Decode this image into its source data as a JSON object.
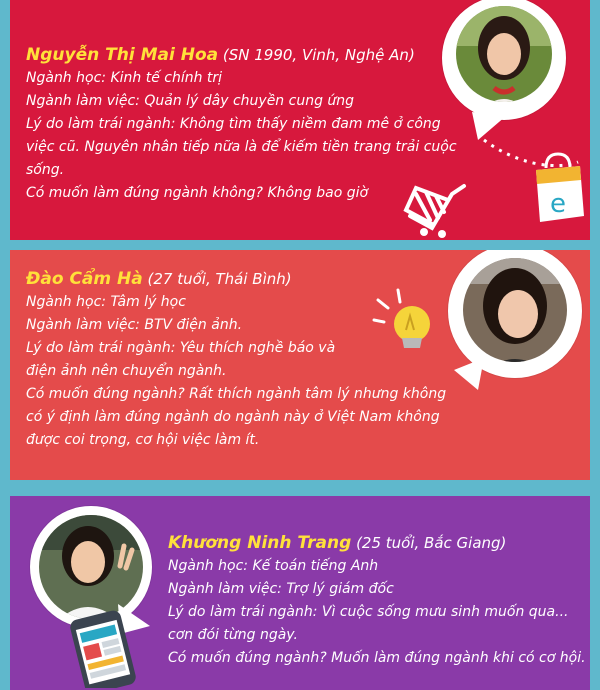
{
  "profiles": [
    {
      "name": "Nguyễn Thị Mai Hoa",
      "info": "(SN 1990, Vinh, Nghệ An)",
      "lines": [
        "Ngành học: Kinh tế chính trị",
        "Ngành làm việc: Quản lý dây chuyền cung ứng",
        "Lý do làm trái ngành: Không tìm thấy niềm đam mê ở công",
        "việc cũ. Nguyên nhân tiếp nữa là để kiếm tiền trang trải cuộc",
        "sống.",
        "Có muốn làm đúng ngành không? Không bao giờ"
      ],
      "icon_letter": "e"
    },
    {
      "name": "Đào Cẩm Hà",
      "info": "(27 tuổi, Thái Bình)",
      "lines": [
        "Ngành học: Tâm lý học",
        "Ngành làm việc: BTV điện ảnh.",
        "Lý do làm trái ngành: Yêu thích nghề báo và",
        "điện ảnh nên chuyển ngành.",
        "Có muốn đúng ngành? Rất thích ngành tâm lý nhưng không",
        "có ý định làm đúng ngành do ngành này ở Việt Nam không",
        "được coi trọng, cơ hội việc làm ít."
      ]
    },
    {
      "name": "Khương Ninh Trang",
      "info": "(25 tuổi, Bắc Giang)",
      "lines": [
        "Ngành học: Kế toán tiếng Anh",
        "Ngành làm việc: Trợ lý giám đốc",
        "Lý do làm trái ngành: Vì cuộc sống mưu sinh muốn qua...",
        "cơn đói từng ngày.",
        "Có muốn đúng ngành? Muốn làm đúng ngành khi có cơ hội."
      ]
    }
  ],
  "colors": {
    "panel1": "#d7183d",
    "panel2": "#e44b4b",
    "panel3": "#8a3aa8",
    "name": "#ffe13a",
    "frame": "#5fb8cc"
  }
}
